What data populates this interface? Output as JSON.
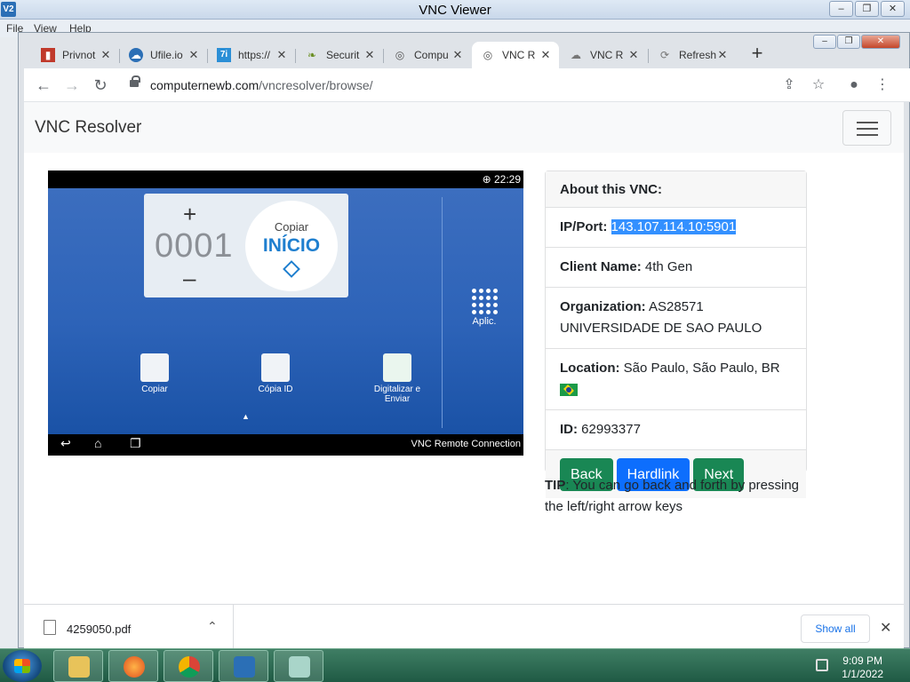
{
  "outer_window": {
    "title": "VNC Viewer",
    "icon_text": "V2",
    "menu": [
      "File",
      "View",
      "Help"
    ],
    "controls": {
      "minimize": "–",
      "restore": "❐",
      "close": "✕"
    }
  },
  "browser": {
    "tabs": [
      {
        "label": "Privnot",
        "icon": "lock-icon",
        "color": "#c0392b"
      },
      {
        "label": "Ufile.io",
        "icon": "cloud-icon",
        "color": "#2b6fb6"
      },
      {
        "label": "https://",
        "icon": "7i-icon",
        "color": "#2b8fd6"
      },
      {
        "label": "Securit",
        "icon": "leaf-icon",
        "color": "#6a8e23"
      },
      {
        "label": "Compu",
        "icon": "target-icon",
        "color": "#555555"
      },
      {
        "label": "VNC R",
        "icon": "target-icon",
        "color": "#555555",
        "active": true
      },
      {
        "label": "VNC R",
        "icon": "cloud-icon",
        "color": "#777777"
      },
      {
        "label": "Refresh",
        "icon": "refresh-icon",
        "color": "#777777"
      }
    ],
    "new_tab": "+",
    "tab_close": "✕",
    "address": {
      "host": "computernewb.com",
      "path": "/vncresolver/browse/"
    }
  },
  "page": {
    "brand": "VNC Resolver",
    "screenshot": {
      "time": "22:29",
      "count": "0001",
      "start_top": "Copiar",
      "start_main": "INÍCIO",
      "apps_label": "Aplic.",
      "icons": [
        "Copiar",
        "Cópia ID",
        "Digitalizar e Enviar"
      ],
      "remote_label": "VNC Remote Connection"
    },
    "card": {
      "header": "About this VNC:",
      "ip_label": "IP/Port:",
      "ip_value": "143.107.114.10:5901",
      "client_label": "Client Name:",
      "client_value": "4th Gen",
      "org_label": "Organization:",
      "org_value": "AS28571 UNIVERSIDADE DE SAO PAULO",
      "loc_label": "Location:",
      "loc_value": "São Paulo, São Paulo, BR",
      "id_label": "ID:",
      "id_value": "62993377",
      "buttons": {
        "back": "Back",
        "hardlink": "Hardlink",
        "next": "Next"
      }
    },
    "tip_label": "TIP",
    "tip_text": ": You can go back and forth by pressing the left/right arrow keys"
  },
  "downloads": {
    "file": "4259050.pdf",
    "show_all": "Show all"
  },
  "taskbar": {
    "time": "9:09 PM",
    "date": "1/1/2022"
  }
}
